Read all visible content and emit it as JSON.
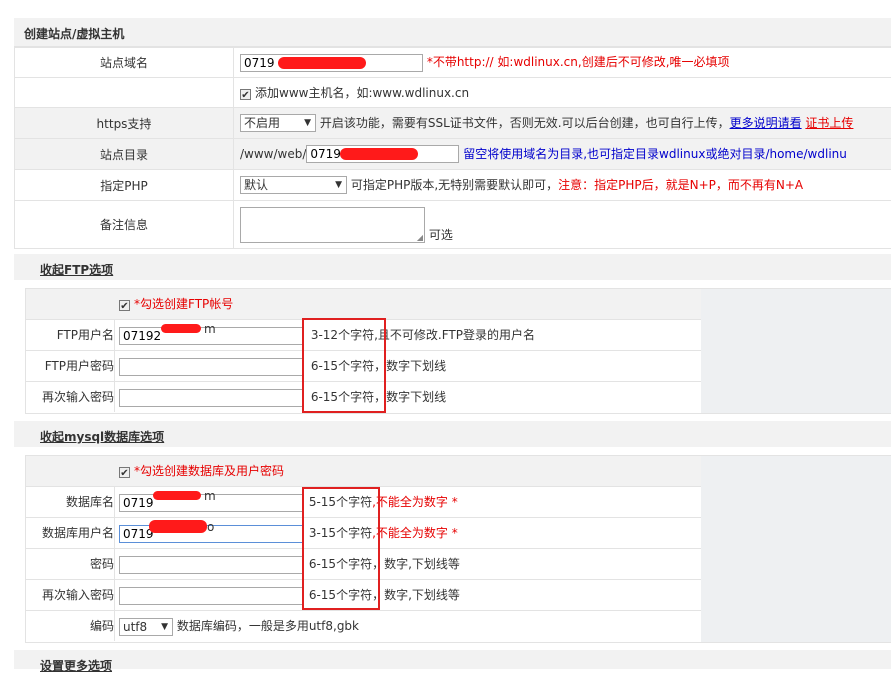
{
  "page_title": "创建站点/虚拟主机",
  "form": {
    "domain": {
      "label": "站点域名",
      "value": "0719",
      "hint_black": "*不带http:// 如:wdlinux.cn,",
      "hint_red": "创建后不可修改,唯一必填项"
    },
    "www": {
      "label": "添加www主机名，如:www.wdlinux.cn"
    },
    "https": {
      "label": "https支持",
      "select": "不启用",
      "hint": "开启该功能，需要有SSL证书文件，否则无效.可以后台创建，也可自行上传，",
      "link": "更多说明请看",
      "link2": "证书上传"
    },
    "dir": {
      "label": "站点目录",
      "prefix": "/www/web/",
      "value": "0719",
      "hint": "留空将使用域名为目录,也可指定目录wdlinux或绝对目录/home/wdlinu"
    },
    "php": {
      "label": "指定PHP",
      "select": "默认",
      "hint_black": "可指定PHP版本,无特别需要默认即可，",
      "hint_red": "注意：指定PHP后，就是N+P，而不再有N+A"
    },
    "note": {
      "label": "备注信息",
      "hint": "可选"
    }
  },
  "ftp": {
    "section_title": "收起FTP选项",
    "checkbox_label": "*勾选创建FTP帐号",
    "rows": [
      {
        "label": "FTP用户名",
        "value": "07192",
        "value_tail": "m",
        "hint_box": "3-12个字符",
        "hint": ",且不可修改.FTP登录的用户名"
      },
      {
        "label": "FTP用户密码",
        "value": "",
        "hint_box": "6-15个字符",
        "hint": "，数字下划线"
      },
      {
        "label": "再次输入密码",
        "value": "",
        "hint_box": "6-15个字符",
        "hint": "，数字下划线"
      }
    ]
  },
  "mysql": {
    "section_title": "收起mysql数据库选项",
    "checkbox_label": "*勾选创建数据库及用户密码",
    "rows": [
      {
        "label": "数据库名",
        "value": "0719",
        "value_tail": "m",
        "hint_box": "5-15个字符",
        "hint_red": ",不能全为数字 *"
      },
      {
        "label": "数据库用户名",
        "value": "0719",
        "value_tail": "o",
        "hint_box": "3-15个字符",
        "hint_red": ",不能全为数字 *"
      },
      {
        "label": "密码",
        "value": "",
        "hint_box": "6-15个字符",
        "hint": "，数字,下划线等"
      },
      {
        "label": "再次输入密码",
        "value": "",
        "hint_box": "6-15个字符",
        "hint": "，数字,下划线等"
      },
      {
        "label": "编码",
        "select": "utf8",
        "hint": "数据库编码，一般是多用utf8,gbk"
      }
    ]
  },
  "more": {
    "section_title": "设置更多选项"
  },
  "colors": {
    "accent_red": "#e60000",
    "link_blue": "#0000cc",
    "highlight_box": "#e02020",
    "header_bg": "#f2f2f2"
  }
}
